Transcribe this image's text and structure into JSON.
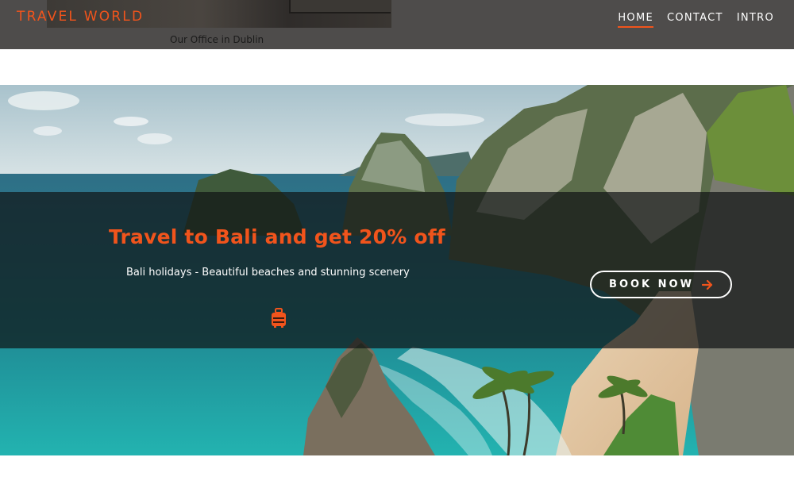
{
  "header": {
    "logo": "TRAVEL WORLD",
    "office_caption": "Our Office in Dublin",
    "nav": [
      {
        "label": "HOME",
        "active": true
      },
      {
        "label": "CONTACT",
        "active": false
      },
      {
        "label": "INTRO",
        "active": false
      }
    ]
  },
  "hero": {
    "headline": "Travel to Bali and get 20% off",
    "subline": "Bali holidays - Beautiful beaches and stunning scenery",
    "cta_label": "BOOK NOW",
    "cta_icon": "arrow-right-icon",
    "badge_icon": "luggage-icon"
  },
  "colors": {
    "accent": "#f1541c",
    "navbar": "#4e4c4b",
    "overlay": "#101214",
    "text_light": "#ffffff"
  }
}
